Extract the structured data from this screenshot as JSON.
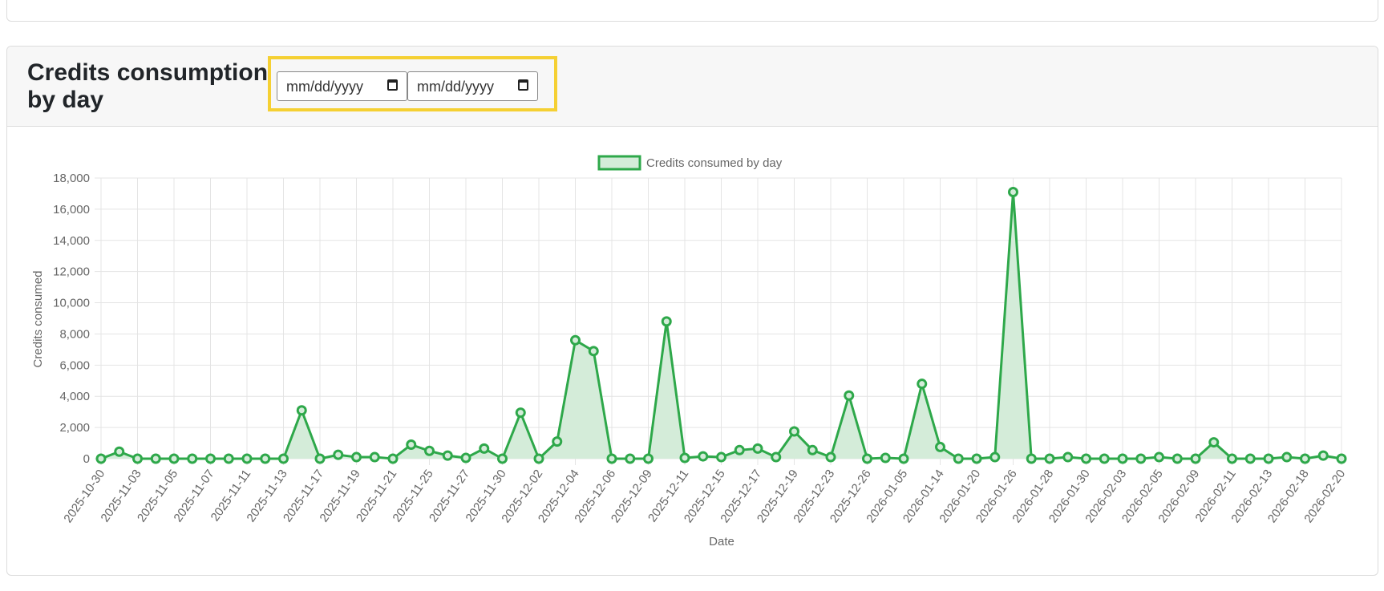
{
  "header": {
    "title": "Credits consumption by day"
  },
  "date_range": {
    "start_placeholder": "mm/dd/yyyy",
    "end_placeholder": "mm/dd/yyyy"
  },
  "chart_data": {
    "type": "area",
    "legend": "Credits consumed by day",
    "legend_position": "top",
    "xlabel": "Date",
    "ylabel": "Credits consumed",
    "ylim": [
      0,
      18000
    ],
    "yticks": [
      "0",
      "2,000",
      "4,000",
      "6,000",
      "8,000",
      "10,000",
      "12,000",
      "14,000",
      "16,000",
      "18,000"
    ],
    "grid": true,
    "color": "#2ea84a",
    "fill_color": "#d4ecd9",
    "categories": [
      "2025-10-30",
      "",
      "2025-11-03",
      "",
      "2025-11-05",
      "",
      "2025-11-07",
      "",
      "2025-11-11",
      "",
      "2025-11-13",
      "",
      "2025-11-17",
      "",
      "2025-11-19",
      "",
      "2025-11-21",
      "",
      "2025-11-25",
      "",
      "2025-11-27",
      "",
      "2025-11-30",
      "",
      "2025-12-02",
      "",
      "2025-12-04",
      "",
      "2025-12-06",
      "",
      "2025-12-09",
      "",
      "2025-12-11",
      "",
      "2025-12-15",
      "",
      "2025-12-17",
      "",
      "2025-12-19",
      "",
      "2025-12-23",
      "",
      "2025-12-26",
      "",
      "2026-01-05",
      "",
      "2026-01-14",
      "",
      "2026-01-20",
      "",
      "2026-01-26",
      "",
      "2026-01-28",
      "",
      "2026-01-30",
      "",
      "2026-02-03",
      "",
      "2026-02-05",
      "",
      "2026-02-09",
      "",
      "2026-02-11",
      "",
      "2026-02-13",
      "",
      "2026-02-18",
      "",
      "2026-02-20"
    ],
    "values": [
      0,
      450,
      0,
      0,
      0,
      0,
      0,
      0,
      0,
      0,
      0,
      3100,
      0,
      250,
      100,
      100,
      0,
      900,
      500,
      200,
      50,
      650,
      0,
      2950,
      0,
      1100,
      7600,
      6900,
      0,
      0,
      0,
      8800,
      50,
      150,
      100,
      550,
      650,
      100,
      1750,
      550,
      100,
      4050,
      0,
      50,
      0,
      4800,
      750,
      0,
      0,
      100,
      17100,
      0,
      0,
      100,
      0,
      0,
      0,
      0,
      100,
      0,
      0,
      1050,
      0,
      0,
      0,
      100,
      0,
      200,
      0
    ]
  }
}
